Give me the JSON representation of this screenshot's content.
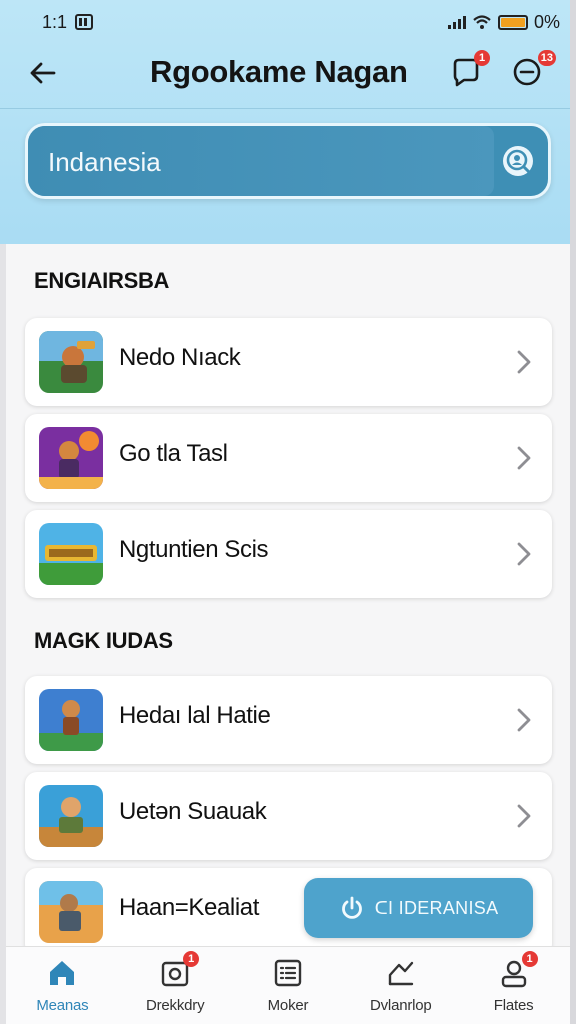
{
  "status_bar": {
    "time": "1:1",
    "battery": "0%",
    "icons": [
      "signal-icon",
      "wifi-icon",
      "battery-icon"
    ]
  },
  "header": {
    "title": "Rgookame Nagan",
    "back_icon": "back-arrow-icon",
    "notif_badge": "1",
    "chat_badge": "13"
  },
  "search": {
    "value": "Indanesia",
    "icon": "search-user-icon"
  },
  "sections": [
    {
      "title": "ENGIAIRSBA",
      "items": [
        {
          "name": "Nedo Nıack"
        },
        {
          "name": "Go tla Tasl"
        },
        {
          "name": "Ngtuntien Scis"
        }
      ]
    },
    {
      "title": "MAGK IUDAS",
      "items": [
        {
          "name": "Hedaı lal Hatie"
        },
        {
          "name": "Uetən Suauak"
        },
        {
          "name": "Haan=Kealiat"
        }
      ]
    }
  ],
  "cta": {
    "label": "ᑕI IDERANISA",
    "icon": "power-icon"
  },
  "tabbar": [
    {
      "label": "Meanas",
      "icon": "home-icon",
      "active": true
    },
    {
      "label": "Drekkdry",
      "icon": "camera-icon",
      "badge": "1"
    },
    {
      "label": "Moker",
      "icon": "list-icon"
    },
    {
      "label": "Dvlanrlop",
      "icon": "edit-icon"
    },
    {
      "label": "Flates",
      "icon": "profile-icon",
      "badge": "1"
    }
  ],
  "colors": {
    "header_bg": "#a9dcf3",
    "search_bg": "#3e8fb5",
    "accent": "#2f86b8",
    "badge": "#e53935",
    "cta_bg": "#4ea3cc"
  }
}
